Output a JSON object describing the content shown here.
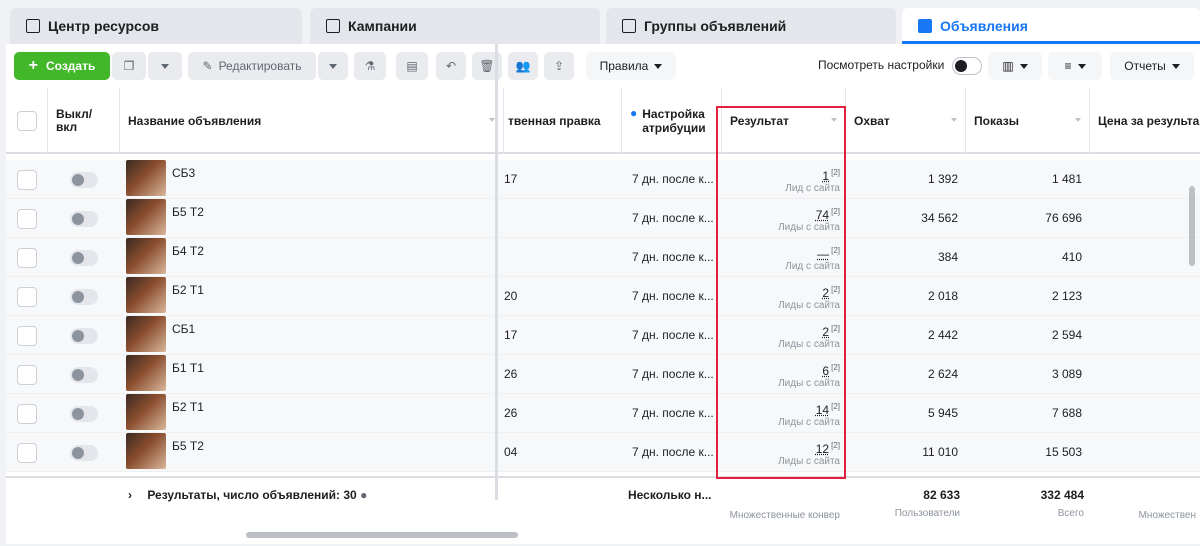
{
  "tabs": [
    {
      "label": "Центр ресурсов",
      "icon": "clipboard-icon"
    },
    {
      "label": "Кампании",
      "icon": "flag-icon"
    },
    {
      "label": "Группы объявлений",
      "icon": "grid-icon"
    },
    {
      "label": "Объявления",
      "icon": "ad-icon"
    }
  ],
  "toolbar": {
    "create": "Создать",
    "edit": "Редактировать",
    "rules": "Правила",
    "view_settings": "Посмотреть настройки",
    "reports": "Отчеты"
  },
  "columns": {
    "toggle": "Выкл/\nвкл",
    "name": "Название объявления",
    "manual": "твенная правка",
    "attribution": "Настройка\nатрибуции",
    "result": "Результат",
    "reach": "Охват",
    "impressions": "Показы",
    "cost": "Цена за результа"
  },
  "rows": [
    {
      "name": "СБ3",
      "manual": "17",
      "attribution": "7 дн. после к...",
      "result": "1",
      "result_note": "Лид с сайта",
      "reach": "1 392",
      "impressions": "1 481"
    },
    {
      "name": "Б5 Т2",
      "manual": "",
      "attribution": "7 дн. после к...",
      "result": "74",
      "result_note": "Лиды с сайта",
      "reach": "34 562",
      "impressions": "76 696"
    },
    {
      "name": "Б4 Т2",
      "manual": "",
      "attribution": "7 дн. после к...",
      "result": "—",
      "result_note": "Лид с сайта",
      "reach": "384",
      "impressions": "410"
    },
    {
      "name": "Б2 Т1",
      "manual": "20",
      "attribution": "7 дн. после к...",
      "result": "2",
      "result_note": "Лиды с сайта",
      "reach": "2 018",
      "impressions": "2 123"
    },
    {
      "name": "СБ1",
      "manual": "17",
      "attribution": "7 дн. после к...",
      "result": "2",
      "result_note": "Лиды с сайта",
      "reach": "2 442",
      "impressions": "2 594"
    },
    {
      "name": "Б1 Т1",
      "manual": "26",
      "attribution": "7 дн. после к...",
      "result": "6",
      "result_note": "Лиды с сайта",
      "reach": "2 624",
      "impressions": "3 089"
    },
    {
      "name": "Б2 Т1",
      "manual": "26",
      "attribution": "7 дн. после к...",
      "result": "14",
      "result_note": "Лиды с сайта",
      "reach": "5 945",
      "impressions": "7 688"
    },
    {
      "name": "Б5 Т2",
      "manual": "04",
      "attribution": "7 дн. после к...",
      "result": "12",
      "result_note": "Лиды с сайта",
      "reach": "11 010",
      "impressions": "15 503"
    }
  ],
  "result_sup": "[2]",
  "footer": {
    "summary": "Результаты, число объявлений: 30",
    "attribution": "Несколько н...",
    "result_sub": "Множественные конвер",
    "reach": "82 633",
    "reach_sub": "Пользователи",
    "impressions": "332 484",
    "impressions_sub": "Всего",
    "cost_sub": "Множествен"
  },
  "colors": {
    "accent": "#1877f2",
    "create": "#42b72a",
    "highlight": "#e41e3f"
  }
}
